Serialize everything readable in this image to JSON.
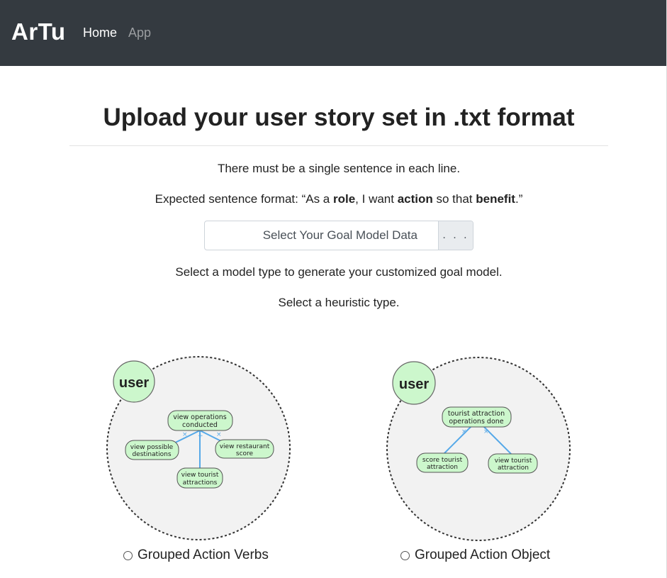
{
  "nav": {
    "brand": "ArTu",
    "home": "Home",
    "app": "App"
  },
  "page": {
    "title": "Upload your user story set in .txt format",
    "line1": "There must be a single sentence in each line.",
    "format": {
      "prefix": "Expected sentence format: “As a ",
      "role": "role",
      "mid1": ", I want ",
      "action": "action",
      "mid2": " so that ",
      "benefit": "benefit",
      "suffix": ".”"
    },
    "file_input": {
      "label": "Select Your Goal Model Data",
      "button": ". . ."
    },
    "line3": "Select a model type to generate your customized goal model.",
    "line4": "Select a heuristic type."
  },
  "options": [
    {
      "label": "Grouped Action Verbs",
      "user": "user",
      "root": [
        "view operations",
        "conducted"
      ],
      "left": [
        "view possible",
        "destinations"
      ],
      "right": [
        "view restaurant",
        "score"
      ],
      "bottom": [
        "view tourist",
        "attractions"
      ]
    },
    {
      "label": "Grouped Action Object",
      "user": "user",
      "root": [
        "tourist attraction",
        "operations done"
      ],
      "left": [
        "score tourist",
        "attraction"
      ],
      "right": [
        "view tourist",
        "attraction"
      ]
    }
  ],
  "colors": {
    "navbar": "#343a40",
    "node_fill": "#ccf7cc",
    "edge": "#56a9e8",
    "circle_fill": "#f2f2f2"
  }
}
